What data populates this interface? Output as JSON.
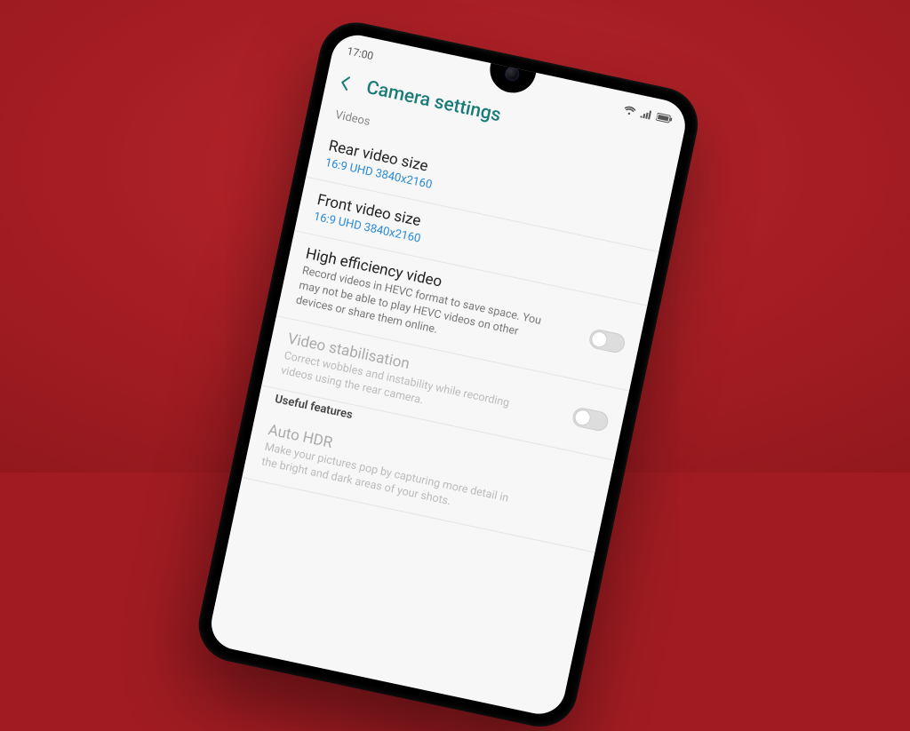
{
  "statusbar": {
    "time": "17:00"
  },
  "header": {
    "title": "Camera settings"
  },
  "section1": {
    "label": "Videos"
  },
  "items": {
    "rear": {
      "title": "Rear video size",
      "sub": "16:9 UHD 3840x2160"
    },
    "front": {
      "title": "Front video size",
      "sub": "16:9 UHD 3840x2160"
    },
    "hevc": {
      "title": "High efficiency video",
      "desc": "Record videos in HEVC format to save space. You may not be able to play HEVC videos on other devices or share them online."
    },
    "stab": {
      "title": "Video stabilisation",
      "desc": "Correct wobbles and instability while recording videos using the rear camera."
    }
  },
  "section2": {
    "label": "Useful features"
  },
  "items2": {
    "hdr": {
      "title": "Auto HDR",
      "desc": "Make your pictures pop by capturing more detail in the bright and dark areas of your shots."
    }
  }
}
